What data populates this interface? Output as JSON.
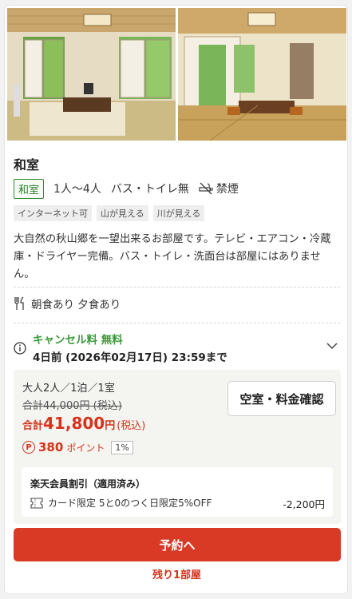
{
  "room": {
    "name": "和室",
    "type_badge": "和室",
    "capacity": "1人～4人",
    "bath": "バス・トイレ無",
    "smoking": "禁煙",
    "tags": [
      "インターネット可",
      "山が見える",
      "川が見える"
    ],
    "description": "大自然の秋山郷を一望出来るお部屋です。テレビ・エアコン・冷蔵庫・ドライヤー完備。バス・トイレ・洗面台は部屋にはありません。"
  },
  "meals": "朝食あり 夕食あり",
  "cancellation": {
    "title": "キャンセル料 無料",
    "deadline": "4日前 (2026年02月17日) 23:59まで"
  },
  "price": {
    "people": "大人2人／1泊／1室",
    "original": "合計44,000円 (税込)",
    "total_prefix": "合計",
    "total_amount": "41,800",
    "total_unit": "円",
    "total_tax": "(税込)",
    "points_icon": "P",
    "points": "380",
    "points_unit": "ポイント",
    "points_rate": "1%"
  },
  "vacancy_button": "空室・料金確認",
  "discount": {
    "title": "楽天会員割引（適用済み）",
    "desc": "カード限定 5と0のつく日限定5%OFF",
    "amount": "-2,200円"
  },
  "reserve_button": "予約へ",
  "remaining": "残り1部屋",
  "colors": {
    "accent_red": "#d93a26",
    "green": "#3a9a3a",
    "price_bg": "#f4f4f0"
  },
  "icons": [
    "no-smoking-icon",
    "cutlery-icon",
    "info-icon",
    "chevron-down-icon",
    "point-icon",
    "coupon-icon"
  ]
}
